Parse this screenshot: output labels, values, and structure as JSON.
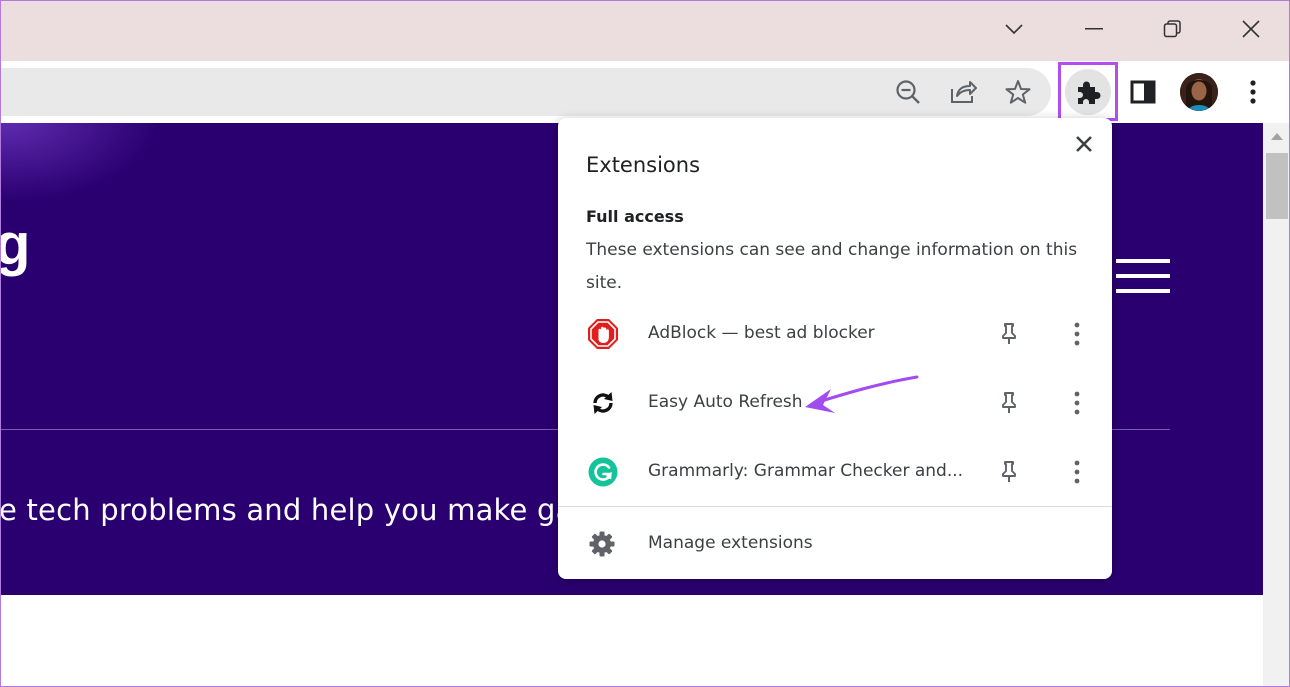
{
  "window": {
    "controls": [
      "tab-search",
      "minimize",
      "restore",
      "close"
    ]
  },
  "toolbar": {
    "icons": [
      "zoom-out-icon",
      "share-icon",
      "bookmark-star-icon",
      "extensions-puzzle-icon",
      "side-panel-icon",
      "profile-avatar",
      "menu-kebab-icon"
    ]
  },
  "page": {
    "logo_fragment": "g",
    "hero_text": "e tech problems and help you make gadge"
  },
  "extensions_popup": {
    "title": "Extensions",
    "section_heading": "Full access",
    "section_description": "These extensions can see and change information on this site.",
    "items": [
      {
        "name": "AdBlock — best ad blocker",
        "icon": "adblock-hand-icon"
      },
      {
        "name": "Easy Auto Refresh",
        "icon": "refresh-arrows-icon"
      },
      {
        "name": "Grammarly: Grammar Checker and...",
        "icon": "grammarly-g-icon"
      }
    ],
    "manage_label": "Manage extensions"
  },
  "colors": {
    "hero_bg": "#2a0070",
    "highlight": "#b04ef0",
    "titlebar": "#ecdede"
  }
}
